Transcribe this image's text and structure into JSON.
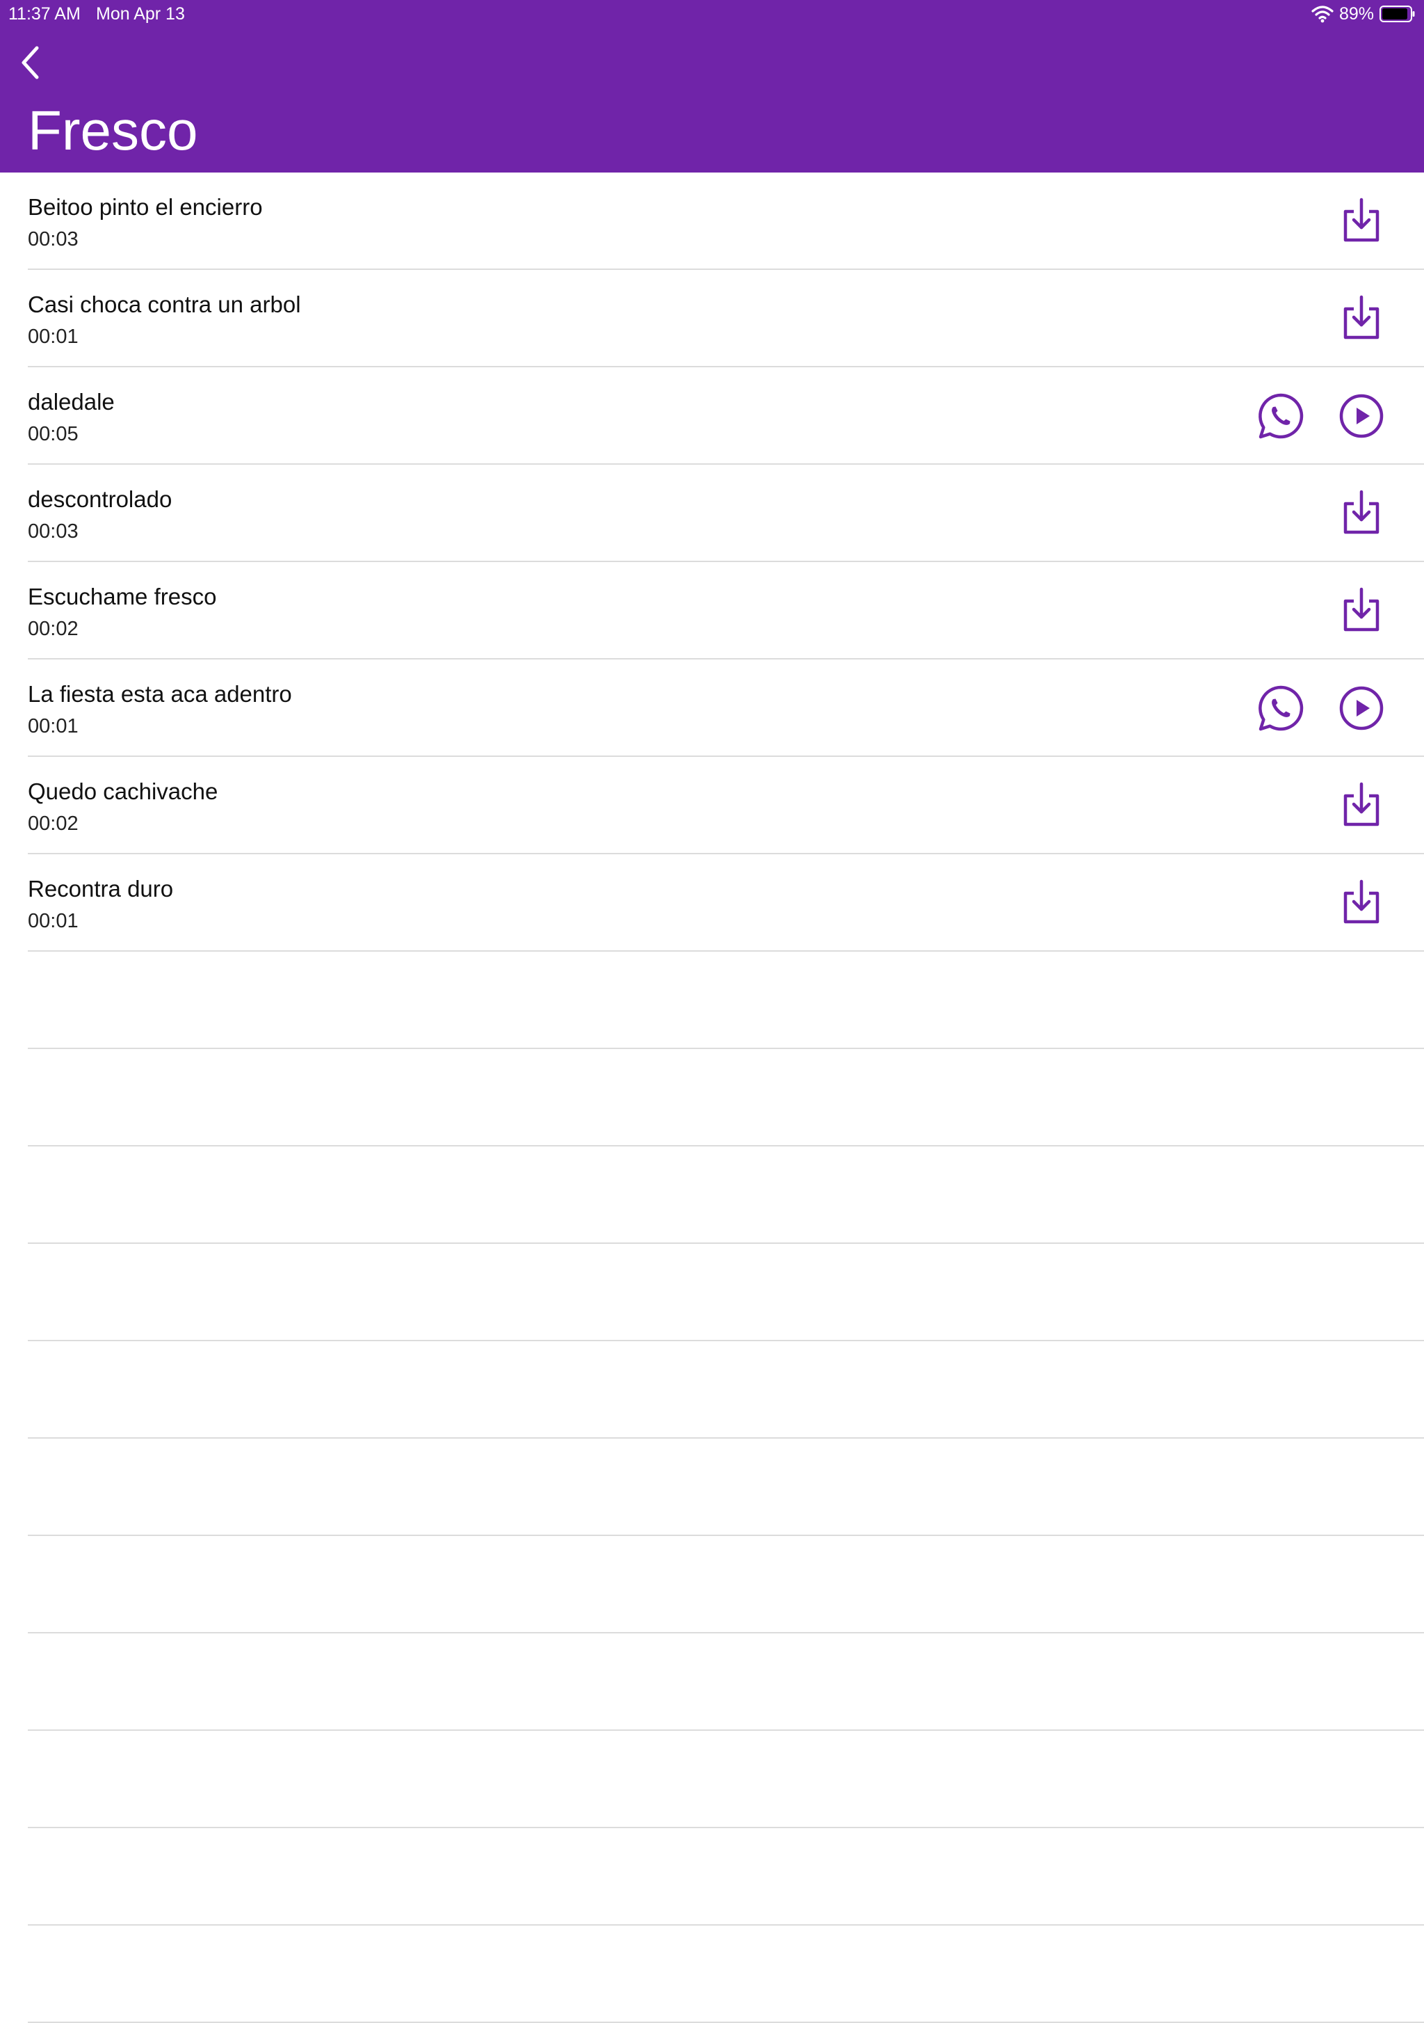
{
  "status_bar": {
    "time": "11:37 AM",
    "date": "Mon Apr 13",
    "battery": "89%"
  },
  "header": {
    "title": "Fresco",
    "back_icon": "chevron-left-icon"
  },
  "colors": {
    "accent": "#7024a9",
    "separator": "#dcdcdc"
  },
  "sounds": [
    {
      "title": "Beitoo pinto el encierro",
      "duration": "00:03",
      "state": "download"
    },
    {
      "title": "Casi choca contra un arbol",
      "duration": "00:01",
      "state": "download"
    },
    {
      "title": "daledale",
      "duration": "00:05",
      "state": "downloaded"
    },
    {
      "title": "descontrolado",
      "duration": "00:03",
      "state": "download"
    },
    {
      "title": "Escuchame fresco",
      "duration": "00:02",
      "state": "download"
    },
    {
      "title": "La fiesta esta aca adentro",
      "duration": "00:01",
      "state": "downloaded"
    },
    {
      "title": "Quedo cachivache",
      "duration": "00:02",
      "state": "download"
    },
    {
      "title": "Recontra duro",
      "duration": "00:01",
      "state": "download"
    }
  ]
}
